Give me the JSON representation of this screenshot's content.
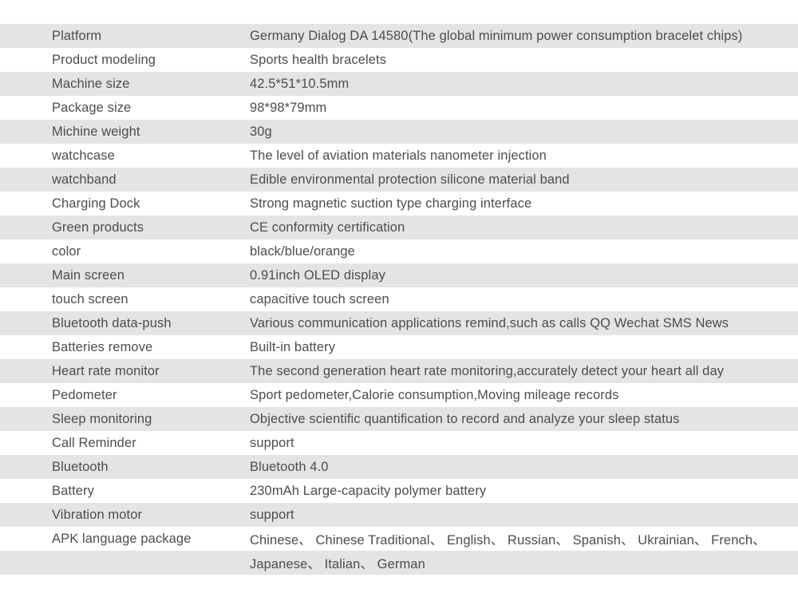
{
  "table": {
    "rows": [
      {
        "label": "Platform",
        "value": "Germany Dialog DA 14580(The global minimum power consumption bracelet chips)"
      },
      {
        "label": "Product modeling",
        "value": "Sports health bracelets"
      },
      {
        "label": "Machine size",
        "value": "42.5*51*10.5mm"
      },
      {
        "label": "Package size",
        "value": "98*98*79mm"
      },
      {
        "label": "Michine weight",
        "value": "30g"
      },
      {
        "label": "watchcase",
        "value": "The level of aviation materials nanometer injection"
      },
      {
        "label": "watchband",
        "value": "Edible environmental protection silicone material band"
      },
      {
        "label": "Charging Dock",
        "value": "Strong magnetic suction type charging interface"
      },
      {
        "label": "Green products",
        "value": "CE conformity certification"
      },
      {
        "label": "color",
        "value": "black/blue/orange"
      },
      {
        "label": "Main screen",
        "value": "0.91inch OLED display"
      },
      {
        "label": "touch screen",
        "value": "capacitive touch screen"
      },
      {
        "label": "Bluetooth data-push",
        "value": "Various communication applications remind,such as calls QQ Wechat SMS News"
      },
      {
        "label": "Batteries remove",
        "value": "Built-in battery"
      },
      {
        "label": "Heart rate monitor",
        "value": "The second generation heart rate monitoring,accurately detect your heart all day"
      },
      {
        "label": "Pedometer",
        "value": "Sport pedometer,Calorie consumption,Moving mileage records"
      },
      {
        "label": "Sleep monitoring",
        "value": "Objective scientific quantification to record and analyze your sleep status"
      },
      {
        "label": "Call Reminder",
        "value": "support"
      },
      {
        "label": "Bluetooth",
        "value": "Bluetooth 4.0"
      },
      {
        "label": "Battery",
        "value": "230mAh Large-capacity  polymer battery"
      },
      {
        "label": "Vibration motor",
        "value": "support"
      },
      {
        "label": "APK language package",
        "value": "Chinese、 Chinese Traditional、 English、 Russian、 Spanish、 Ukrainian、 French、"
      },
      {
        "label": "",
        "value": "Japanese、 Italian、 German"
      }
    ]
  },
  "colors": {
    "stripe_gray": "#e4e4e4",
    "stripe_white": "#ffffff",
    "text": "#4d4d4d",
    "page_background": "#ffffff"
  }
}
